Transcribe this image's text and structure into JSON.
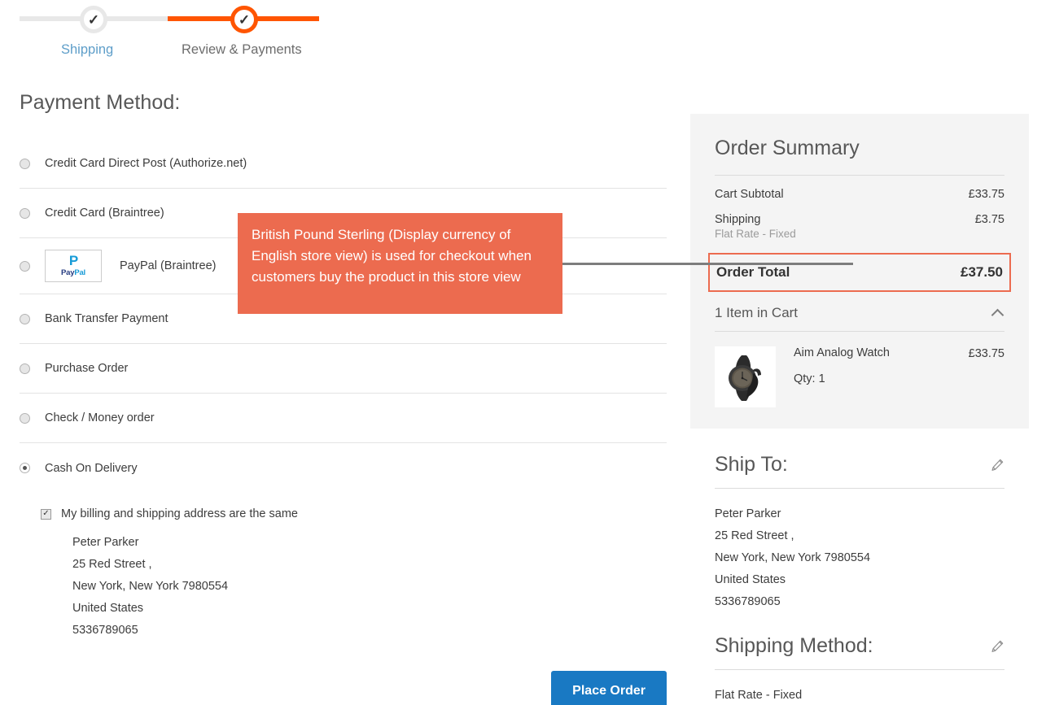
{
  "progress": {
    "steps": [
      {
        "label": "Shipping",
        "state": "done",
        "icon": "check-icon"
      },
      {
        "label": "Review & Payments",
        "state": "active",
        "icon": "check-icon"
      }
    ]
  },
  "payment": {
    "heading": "Payment Method:",
    "methods": [
      {
        "label": "Credit Card Direct Post (Authorize.net)",
        "selected": false,
        "logo": null
      },
      {
        "label": "Credit Card (Braintree)",
        "selected": false,
        "logo": null
      },
      {
        "label": "PayPal (Braintree)",
        "selected": false,
        "logo": "paypal-logo",
        "logo_mark": "P",
        "logo_text_a": "Pay",
        "logo_text_b": "Pal"
      },
      {
        "label": "Bank Transfer Payment",
        "selected": false,
        "logo": null
      },
      {
        "label": "Purchase Order",
        "selected": false,
        "logo": null
      },
      {
        "label": "Check / Money order",
        "selected": false,
        "logo": null
      },
      {
        "label": "Cash On Delivery",
        "selected": true,
        "logo": null
      }
    ],
    "same_address_label": "My billing and shipping address are the same",
    "same_address_checked": true,
    "billing_address": [
      "Peter Parker",
      "25 Red Street ,",
      "New York, New York 7980554",
      "United States",
      "5336789065"
    ],
    "place_order_label": "Place Order"
  },
  "summary": {
    "title": "Order Summary",
    "rows": [
      {
        "label": "Cart Subtotal",
        "sub": null,
        "value": "£33.75"
      },
      {
        "label": "Shipping",
        "sub": "Flat Rate - Fixed",
        "value": "£3.75"
      }
    ],
    "total_label": "Order Total",
    "total_value": "£37.50",
    "items_label": "1 Item in Cart",
    "items_toggle_icon": "chevron-up-icon",
    "items": [
      {
        "name": "Aim Analog Watch",
        "qty": "Qty: 1",
        "price": "£33.75",
        "image": "watch-thumbnail"
      }
    ]
  },
  "ship_to": {
    "title": "Ship To:",
    "edit_icon": "pencil-icon",
    "lines": [
      "Peter Parker",
      "25 Red Street ,",
      "New York, New York 7980554",
      "United States",
      "5336789065"
    ]
  },
  "shipping_method": {
    "title": "Shipping Method:",
    "edit_icon": "pencil-icon",
    "value": "Flat Rate - Fixed"
  },
  "annotation": {
    "text": "British Pound Sterling (Display currency of English store view) is used for checkout when customers buy the product in this store view",
    "color": "#ec6b4f",
    "connector_color": "#7d7d7d"
  },
  "colors": {
    "accent_orange": "#ff5501",
    "annotation_orange": "#ec6b4f",
    "button_blue": "#1979c3",
    "panel_gray": "#f4f4f4",
    "step_link_blue": "#5e9ec9"
  }
}
